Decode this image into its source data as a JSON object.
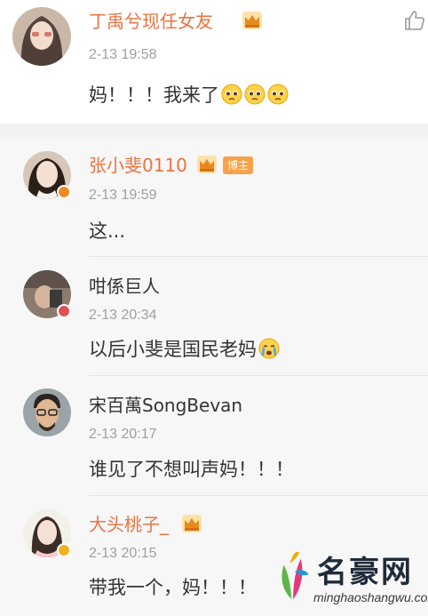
{
  "main_comment": {
    "username": "丁禹兮现任女友",
    "time": "2-13 19:58",
    "text": "妈！！！我来了"
  },
  "replies": [
    {
      "username": "张小斐0110",
      "host_badge": "博主",
      "time": "2-13 19:59",
      "text": "这..."
    },
    {
      "username": "咁係巨人",
      "time": "2-13 20:34",
      "text": "以后小斐是国民老妈"
    },
    {
      "username": "宋百萬SongBevan",
      "time": "2-13 20:17",
      "text": "谁见了不想叫声妈！！！"
    },
    {
      "username": "大头桃子_",
      "time": "2-13 20:15",
      "text": "带我一个，妈！！！"
    }
  ],
  "watermark": {
    "title": "名豪网",
    "url": "minghaoshangwu.com"
  },
  "icons": [
    "thumbs-up-icon",
    "crown-icon",
    "pleading-face-emoji",
    "crying-face-emoji",
    "verified-badge-icon"
  ],
  "colors": {
    "accent_name": "#eb7340",
    "host_badge": "#f6a24a",
    "time_gray": "#a0a0a0",
    "reply_bg": "#f7f7f7"
  }
}
